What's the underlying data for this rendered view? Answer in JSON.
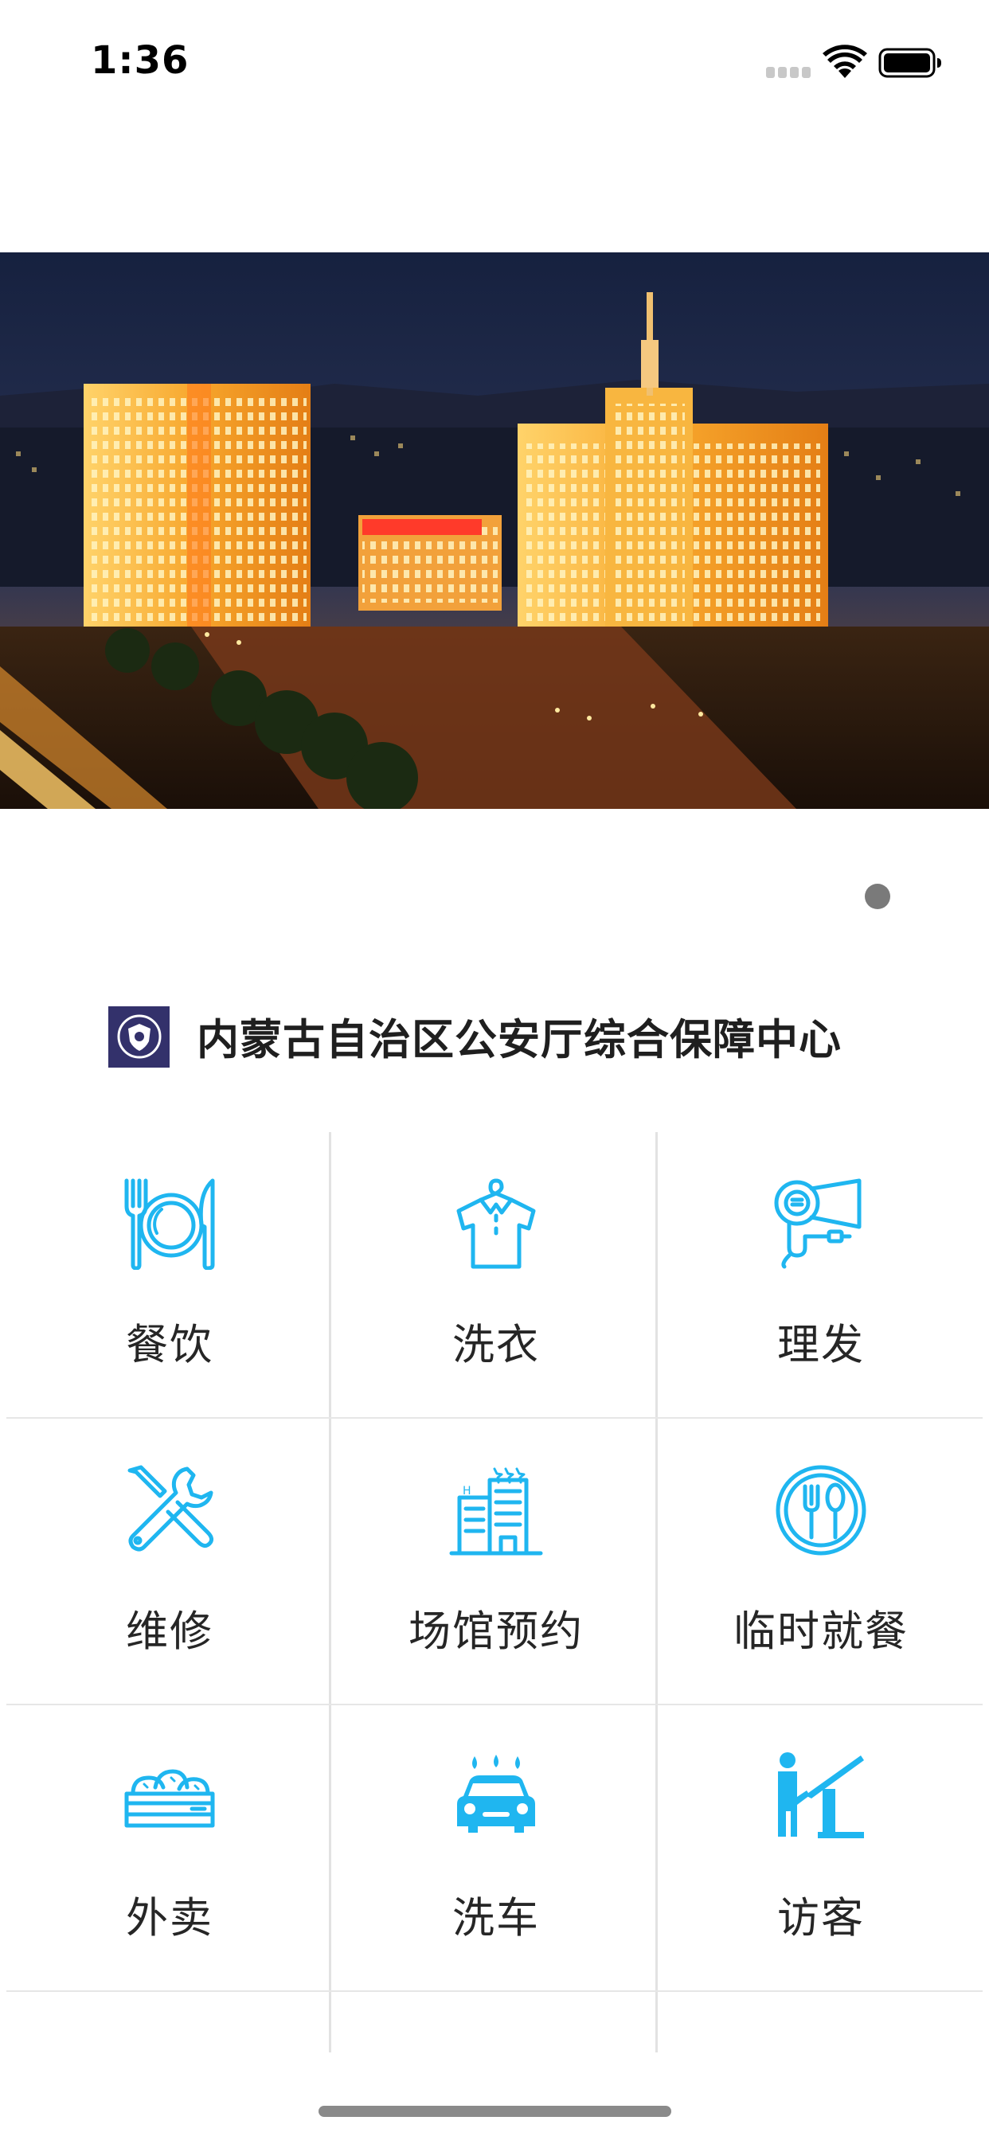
{
  "status_bar": {
    "time": "1:36",
    "signal_icon": "cellular-signal-icon",
    "wifi_icon": "wifi-icon",
    "battery_icon": "battery-icon"
  },
  "banner": {
    "image": "night-view-of-government-buildings",
    "carousel_active_index": 0
  },
  "header": {
    "logo_icon": "police-shield-logo-icon",
    "title": "内蒙古自治区公安厅综合保障中心"
  },
  "services": [
    {
      "label": "餐饮",
      "icon": "dining-plate-icon"
    },
    {
      "label": "洗衣",
      "icon": "shirt-hanger-icon"
    },
    {
      "label": "理发",
      "icon": "hair-dryer-icon"
    },
    {
      "label": "维修",
      "icon": "wrench-screwdriver-icon"
    },
    {
      "label": "场馆预约",
      "icon": "hotel-building-icon"
    },
    {
      "label": "临时就餐",
      "icon": "fork-spoon-circle-icon"
    },
    {
      "label": "外卖",
      "icon": "takeout-buns-icon"
    },
    {
      "label": "洗车",
      "icon": "car-wash-icon"
    },
    {
      "label": "访客",
      "icon": "visitor-gate-icon"
    },
    {
      "label": "",
      "icon": "partial-service-icon"
    }
  ],
  "colors": {
    "accent": "#1fb6f0",
    "logo_bg": "#33316b",
    "divider": "#e2e2e2",
    "page_dot": "#7a7a7a"
  }
}
